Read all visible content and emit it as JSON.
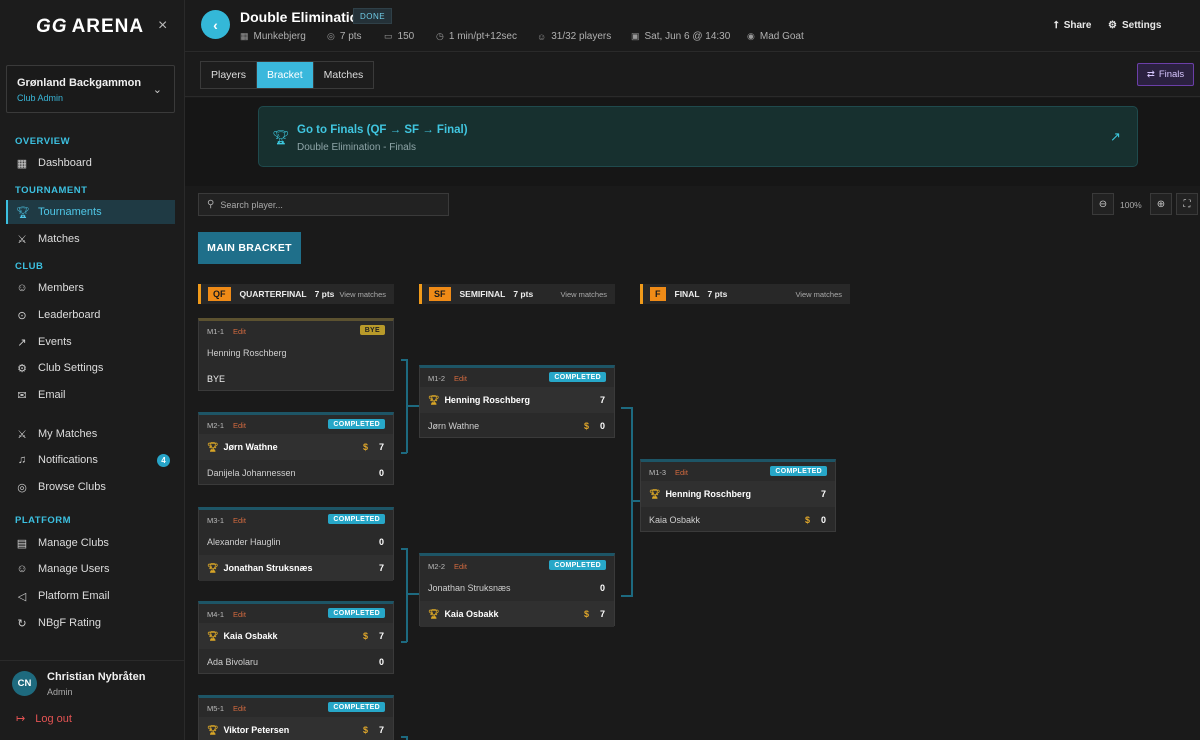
{
  "sidebar": {
    "logo": {
      "mark": "GG",
      "text": "ARENA"
    },
    "close": "×",
    "club": {
      "name": "Grønland Backgammon",
      "role": "Club Admin"
    },
    "sections": {
      "overview": "OVERVIEW",
      "tournament": "TOURNAMENT",
      "club": "CLUB",
      "platform": "PLATFORM"
    },
    "items": {
      "dashboard": "Dashboard",
      "tournaments": "Tournaments",
      "matches": "Matches",
      "members": "Members",
      "leaderboard": "Leaderboard",
      "events": "Events",
      "club_settings": "Club Settings",
      "email": "Email",
      "my_matches": "My Matches",
      "notifications": "Notifications",
      "notifications_count": "4",
      "browse_clubs": "Browse Clubs",
      "manage_clubs": "Manage Clubs",
      "manage_users": "Manage Users",
      "platform_email": "Platform Email",
      "nbgf_rating": "NBgF Rating"
    },
    "user": {
      "initials": "CN",
      "name": "Christian Nybråten",
      "role": "Admin"
    },
    "logout": "Log out"
  },
  "header": {
    "title": "Double Elimination",
    "status": "DONE",
    "meta": {
      "venue": "Munkebjerg",
      "points": "7 pts",
      "rating": "150",
      "time_control": "1 min/pt+12sec",
      "players": "31/32 players",
      "date": "Sat, Jun 6 @ 14:30",
      "location": "Mad Goat"
    },
    "share": "Share",
    "settings": "Settings"
  },
  "tabs": [
    {
      "label": "Players"
    },
    {
      "label": "Bracket"
    },
    {
      "label": "Matches"
    }
  ],
  "finals_button": "Finals",
  "banner": {
    "title": "Go to Finals (QF → SF → Final)",
    "subtitle": "Double Elimination - Finals"
  },
  "bracket": {
    "search_placeholder": "Search player...",
    "zoom": "100%",
    "main_label": "MAIN BRACKET",
    "rounds": [
      {
        "code": "QF",
        "name": "QUARTERFINAL",
        "pts": "7 pts",
        "view": "View matches"
      },
      {
        "code": "SF",
        "name": "SEMIFINAL",
        "pts": "7 pts",
        "view": "View matches"
      },
      {
        "code": "F",
        "name": "FINAL",
        "pts": "7 pts",
        "view": "View matches"
      }
    ],
    "matches": {
      "m1_1": {
        "id": "M1-1",
        "edit": "Edit",
        "status": "BYE",
        "p1": "Henning Roschberg",
        "p2": "BYE"
      },
      "m2_1": {
        "id": "M2-1",
        "edit": "Edit",
        "status": "COMPLETED",
        "p1": "Jørn Wathne",
        "s1": "7",
        "p2": "Danijela Johannessen",
        "s2": "0"
      },
      "m3_1": {
        "id": "M3-1",
        "edit": "Edit",
        "status": "COMPLETED",
        "p1": "Alexander Hauglin",
        "s1": "0",
        "p2": "Jonathan Struksnæs",
        "s2": "7"
      },
      "m4_1": {
        "id": "M4-1",
        "edit": "Edit",
        "status": "COMPLETED",
        "p1": "Kaia Osbakk",
        "s1": "7",
        "p2": "Ada Bivolaru",
        "s2": "0"
      },
      "m5_1": {
        "id": "M5-1",
        "edit": "Edit",
        "status": "COMPLETED",
        "p1": "Viktor Petersen",
        "s1": "7"
      },
      "m1_2": {
        "id": "M1-2",
        "edit": "Edit",
        "status": "COMPLETED",
        "p1": "Henning Roschberg",
        "s1": "7",
        "p2": "Jørn Wathne",
        "s2": "0"
      },
      "m2_2": {
        "id": "M2-2",
        "edit": "Edit",
        "status": "COMPLETED",
        "p1": "Jonathan Struksnæs",
        "s1": "0",
        "p2": "Kaia Osbakk",
        "s2": "7"
      },
      "m1_3": {
        "id": "M1-3",
        "edit": "Edit",
        "status": "COMPLETED",
        "p1": "Henning Roschberg",
        "s1": "7",
        "p2": "Kaia Osbakk",
        "s2": "0"
      }
    },
    "coin_symbol": "$"
  }
}
